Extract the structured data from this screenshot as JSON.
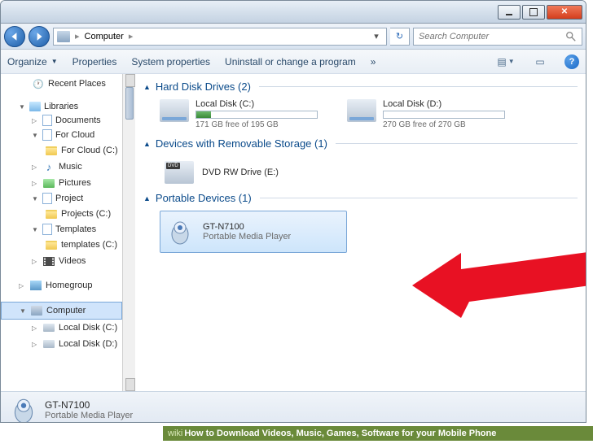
{
  "address": {
    "location": "Computer",
    "separator": "▸"
  },
  "search": {
    "placeholder": "Search Computer"
  },
  "toolbar": {
    "organize": "Organize",
    "properties": "Properties",
    "sysprops": "System properties",
    "uninstall": "Uninstall or change a program",
    "more": "»"
  },
  "sidebar": {
    "recent": "Recent Places",
    "libraries": "Libraries",
    "documents": "Documents",
    "forcloud": "For Cloud",
    "forcloud_c": "For Cloud (C:)",
    "music": "Music",
    "pictures": "Pictures",
    "project": "Project",
    "projects_c": "Projects (C:)",
    "templates": "Templates",
    "templates_c": "templates (C:)",
    "videos": "Videos",
    "homegroup": "Homegroup",
    "computer": "Computer",
    "localdisk_c": "Local Disk (C:)",
    "localdisk_d": "Local Disk (D:)"
  },
  "groups": {
    "hdd": "Hard Disk Drives (2)",
    "removable": "Devices with Removable Storage (1)",
    "portable": "Portable Devices (1)"
  },
  "drives": {
    "c": {
      "name": "Local Disk (C:)",
      "free": "171 GB free of 195 GB",
      "fill_pct": 12
    },
    "d": {
      "name": "Local Disk (D:)",
      "free": "270 GB free of 270 GB",
      "fill_pct": 0
    }
  },
  "removable": {
    "dvd": "DVD RW Drive (E:)"
  },
  "portable": {
    "name": "GT-N7100",
    "sub": "Portable Media Player"
  },
  "status": {
    "name": "GT-N7100",
    "sub": "Portable Media Player"
  },
  "wikihow": {
    "prefix": "wiki",
    "text": "How to Download Videos, Music, Games, Software for your Mobile Phone"
  }
}
